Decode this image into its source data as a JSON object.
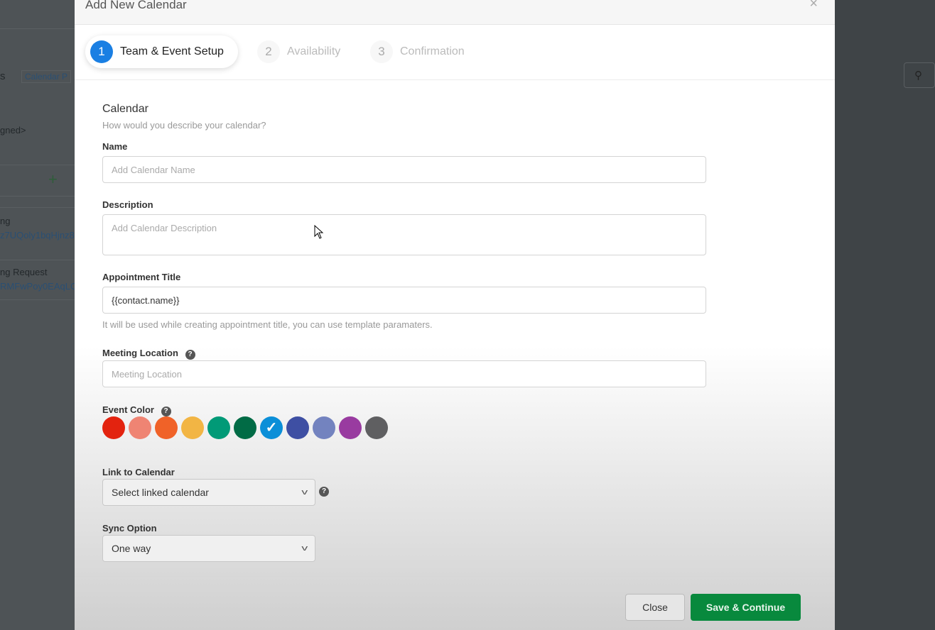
{
  "background": {
    "tab_partial": "s",
    "calendar_link_partial": "Calendar P",
    "assigned_partial": "gned>",
    "rows": [
      {
        "title": "ng",
        "id": "z7UQoly1bqHjnz8"
      },
      {
        "title": "ng Request",
        "id": "RMFwPoy0EAqLC"
      }
    ]
  },
  "modal": {
    "title": "Add New Calendar",
    "steps": [
      {
        "number": "1",
        "label": "Team & Event Setup",
        "active": true
      },
      {
        "number": "2",
        "label": "Availability",
        "active": false
      },
      {
        "number": "3",
        "label": "Confirmation",
        "active": false
      }
    ],
    "section_title": "Calendar",
    "section_subtitle": "How would you describe your calendar?",
    "name": {
      "label": "Name",
      "placeholder": "Add Calendar Name",
      "value": ""
    },
    "description": {
      "label": "Description",
      "placeholder": "Add Calendar Description",
      "value": ""
    },
    "appointment_title": {
      "label": "Appointment Title",
      "value": "{{contact.name}}",
      "hint": "It will be used while creating appointment title, you can use template paramaters."
    },
    "meeting_location": {
      "label": "Meeting Location",
      "placeholder": "Meeting Location",
      "value": ""
    },
    "event_color": {
      "label": "Event Color",
      "colors": [
        "#e3230f",
        "#ef8473",
        "#f06228",
        "#f2b544",
        "#019a77",
        "#016b45",
        "#0b8fd8",
        "#3e4fa3",
        "#7383bf",
        "#993ba0",
        "#5f5f61"
      ],
      "selected_index": 6
    },
    "link_to_calendar": {
      "label": "Link to Calendar",
      "value": "Select linked calendar"
    },
    "sync_option": {
      "label": "Sync Option",
      "value": "One way"
    },
    "close_label": "Close",
    "save_label": "Save & Continue",
    "accent_color": "#1a7fe3",
    "save_color": "#08893d"
  }
}
